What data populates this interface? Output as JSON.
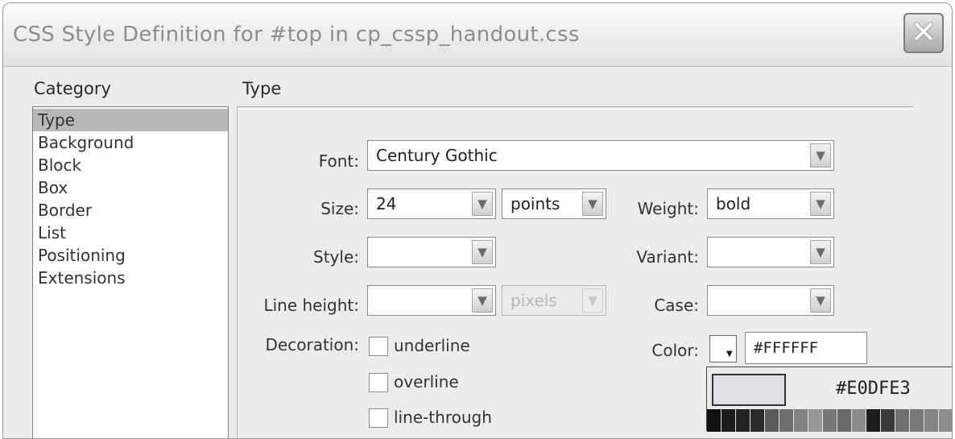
{
  "window": {
    "title": "CSS Style Definition for #top in cp_cssp_handout.css",
    "close_glyph": "✕"
  },
  "category": {
    "heading": "Category",
    "items": [
      "Type",
      "Background",
      "Block",
      "Box",
      "Border",
      "List",
      "Positioning",
      "Extensions"
    ],
    "selected": "Type"
  },
  "panel": {
    "heading": "Type",
    "font": {
      "label": "Font:",
      "value": "Century Gothic"
    },
    "size": {
      "label": "Size:",
      "value": "24",
      "unit": "points"
    },
    "weight": {
      "label": "Weight:",
      "value": "bold"
    },
    "style": {
      "label": "Style:",
      "value": ""
    },
    "variant": {
      "label": "Variant:",
      "value": ""
    },
    "line_height": {
      "label": "Line height:",
      "value": "",
      "unit": "pixels"
    },
    "case": {
      "label": "Case:",
      "value": ""
    },
    "decoration": {
      "label": "Decoration:",
      "options": [
        "underline",
        "overline",
        "line-through"
      ]
    },
    "color": {
      "label": "Color:",
      "value": "#FFFFFF"
    }
  },
  "color_picker": {
    "hex": "#E0DFE3",
    "preview_color": "#E0DFE3",
    "swatches": [
      "#111111",
      "#1a1a1a",
      "#222222",
      "#2b2b2b",
      "#5a5a5a",
      "#6e6e6e",
      "#828282",
      "#969696",
      "#777777",
      "#6a6a6a",
      "#8c8c8c",
      "#1e1e1e",
      "#3a3a3a",
      "#707070",
      "#7a7a7a",
      "#848484",
      "#8e8e8e",
      "#555555"
    ]
  },
  "icons": {
    "dropdown": "chevron-down-icon",
    "close": "close-icon"
  }
}
